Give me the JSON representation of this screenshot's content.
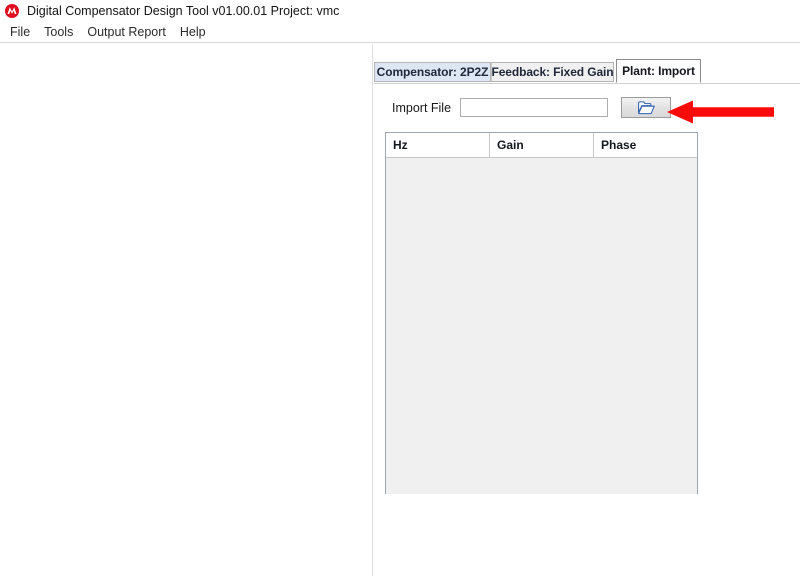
{
  "window": {
    "title": "Digital Compensator Design Tool v01.00.01 Project: vmc",
    "logo_icon": "microchip-logo-icon",
    "accent_color": "#e01020"
  },
  "menubar": {
    "items": [
      {
        "label": "File",
        "name": "menu-file"
      },
      {
        "label": "Tools",
        "name": "menu-tools"
      },
      {
        "label": "Output Report",
        "name": "menu-output-report"
      },
      {
        "label": "Help",
        "name": "menu-help"
      }
    ]
  },
  "tabs": [
    {
      "label": "Compensator: 2P2Z",
      "name": "tab-compensator",
      "selected": false,
      "color": "#dde6f3"
    },
    {
      "label": "Feedback: Fixed Gain",
      "name": "tab-feedback",
      "selected": false,
      "color": "#f0f0f0"
    },
    {
      "label": "Plant: Import",
      "name": "tab-plant-import",
      "selected": true,
      "color": "#fdfdfd"
    }
  ],
  "plant_import": {
    "import_file": {
      "label": "Import File",
      "value": "",
      "placeholder": "",
      "browse_icon": "open-folder-icon",
      "browse_label": ""
    },
    "table": {
      "columns": [
        "Hz",
        "Gain",
        "Phase"
      ],
      "rows": []
    }
  },
  "annotation": {
    "arrow_icon": "left-arrow-annotation-icon",
    "color": "#fb0a0a",
    "points_at": "browse-folder-button"
  }
}
